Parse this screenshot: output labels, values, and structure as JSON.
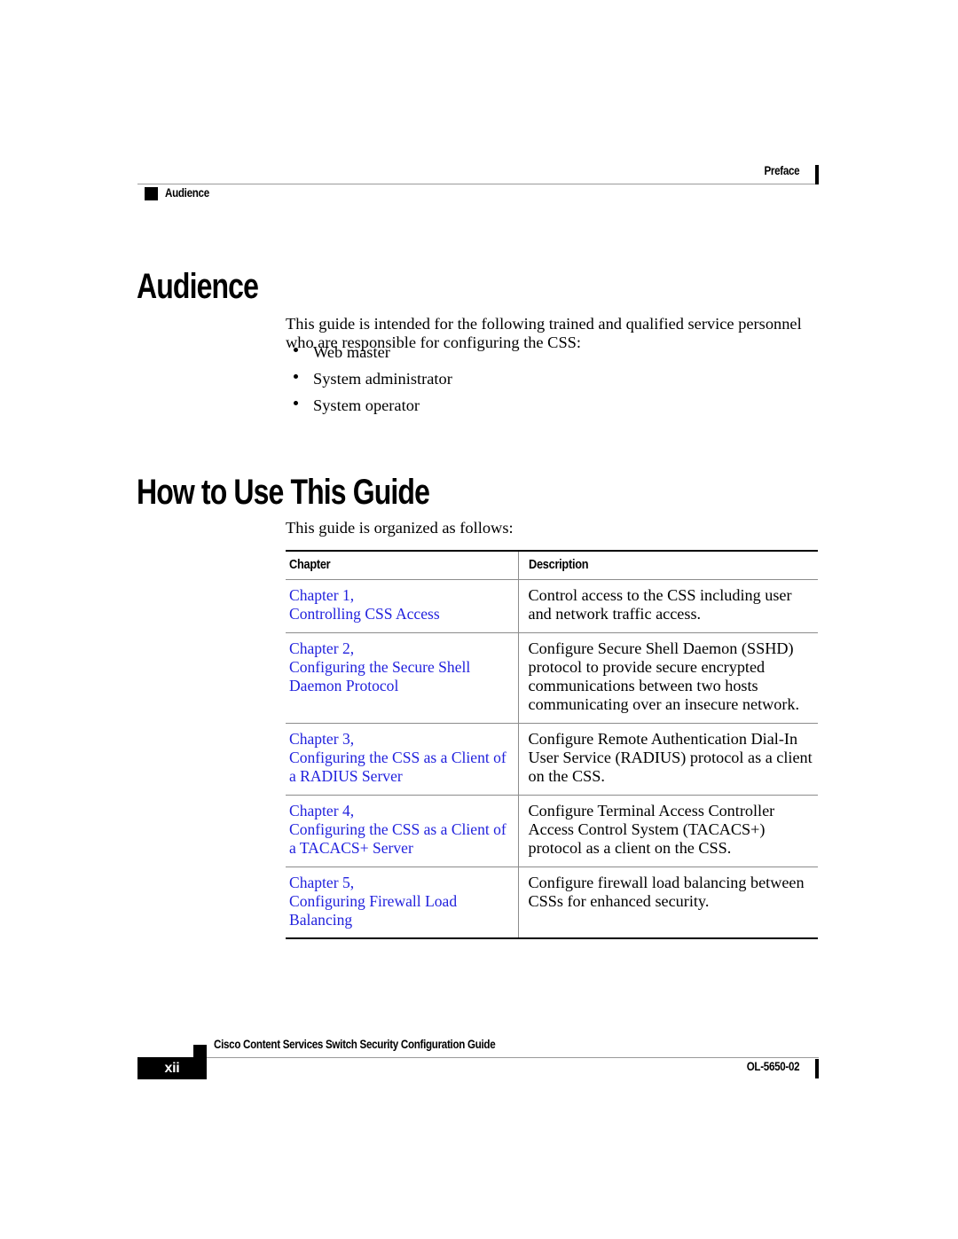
{
  "header": {
    "chapter_name": "Preface",
    "topic": "Audience",
    "marker_icon": "black-square-icon"
  },
  "sections": [
    {
      "heading": "Audience",
      "intro": "This guide is intended for the following trained and qualified service personnel who are responsible for configuring the CSS:",
      "bullets": [
        "Web master",
        "System administrator",
        "System operator"
      ]
    },
    {
      "heading": "How to Use This Guide",
      "intro": "This guide is organized as follows:"
    }
  ],
  "table": {
    "columns": [
      "Chapter",
      "Description"
    ],
    "rows": [
      {
        "link_lines": [
          "Chapter 1,",
          "Controlling CSS Access"
        ],
        "desc_lines": [
          "Control access to the CSS including user",
          "and network traffic access."
        ]
      },
      {
        "link_lines": [
          "Chapter 2,",
          "Configuring the Secure Shell",
          "Daemon Protocol"
        ],
        "desc_lines": [
          "Configure Secure Shell Daemon (SSHD)",
          "protocol to provide secure encrypted",
          "communications between two hosts",
          "communicating over an insecure network."
        ]
      },
      {
        "link_lines": [
          "Chapter 3,",
          "Configuring the CSS as a Client of",
          "a RADIUS Server"
        ],
        "desc_lines": [
          "Configure Remote Authentication Dial-In",
          "User Service (RADIUS) protocol as a client",
          "on the CSS."
        ]
      },
      {
        "link_lines": [
          "Chapter 4,",
          "Configuring the CSS as a Client of",
          "a TACACS+ Server"
        ],
        "desc_lines": [
          "Configure Terminal Access Controller",
          "Access Control System (TACACS+)",
          "protocol as a client on the CSS."
        ]
      },
      {
        "link_lines": [
          "Chapter 5,",
          "Configuring Firewall Load",
          "Balancing"
        ],
        "desc_lines": [
          "Configure firewall load balancing between",
          "CSSs for enhanced security."
        ]
      }
    ]
  },
  "footer": {
    "guide_title": "Cisco Content Services Switch Security Configuration Guide",
    "page_number": "xii",
    "doc_number": "OL-5650-02",
    "marker_icon": "black-square-icon"
  },
  "colors": {
    "link": "#2222dd",
    "rule": "#8c8c8c",
    "text": "#000000"
  }
}
